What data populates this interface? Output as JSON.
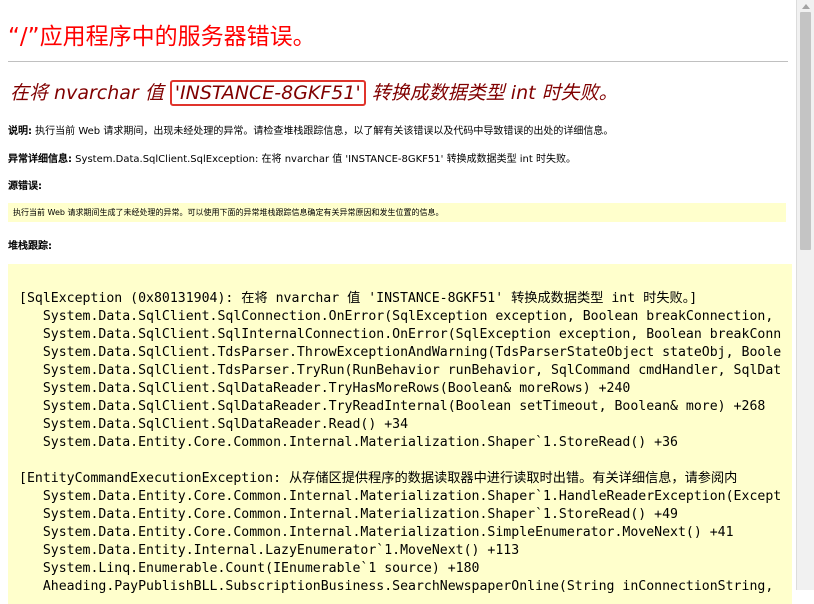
{
  "error": {
    "title": "“/”应用程序中的服务器错误。",
    "message_prefix": "在将 nvarchar 值 ",
    "message_value": "'INSTANCE-8GKF51'",
    "message_suffix": " 转换成数据类型 int 时失败。"
  },
  "description": {
    "label": "说明:",
    "text": " 执行当前 Web 请求期间，出现未经处理的异常。请检查堆栈跟踪信息，以了解有关该错误以及代码中导致错误的出处的详细信息。"
  },
  "exception_details": {
    "label": "异常详细信息:",
    "text": " System.Data.SqlClient.SqlException: 在将 nvarchar 值 'INSTANCE-8GKF51' 转换成数据类型 int 时失败。"
  },
  "source_error": {
    "label": "源错误:",
    "note": "执行当前 Web 请求期间生成了未经处理的异常。可以使用下面的异常堆栈跟踪信息确定有关异常原因和发生位置的信息。"
  },
  "stack_trace": {
    "label": "堆栈跟踪:",
    "text": "[SqlException (0x80131904): 在将 nvarchar 值 'INSTANCE-8GKF51' 转换成数据类型 int 时失败。]\n   System.Data.SqlClient.SqlConnection.OnError(SqlException exception, Boolean breakConnection,\n   System.Data.SqlClient.SqlInternalConnection.OnError(SqlException exception, Boolean breakConn\n   System.Data.SqlClient.TdsParser.ThrowExceptionAndWarning(TdsParserStateObject stateObj, Boole\n   System.Data.SqlClient.TdsParser.TryRun(RunBehavior runBehavior, SqlCommand cmdHandler, SqlDat\n   System.Data.SqlClient.SqlDataReader.TryHasMoreRows(Boolean& moreRows) +240\n   System.Data.SqlClient.SqlDataReader.TryReadInternal(Boolean setTimeout, Boolean& more) +268\n   System.Data.SqlClient.SqlDataReader.Read() +34\n   System.Data.Entity.Core.Common.Internal.Materialization.Shaper`1.StoreRead() +36\n\n[EntityCommandExecutionException: 从存储区提供程序的数据读取器中进行读取时出错。有关详细信息，请参阅内\n   System.Data.Entity.Core.Common.Internal.Materialization.Shaper`1.HandleReaderException(Except\n   System.Data.Entity.Core.Common.Internal.Materialization.Shaper`1.StoreRead() +49\n   System.Data.Entity.Core.Common.Internal.Materialization.SimpleEnumerator.MoveNext() +41\n   System.Data.Entity.Internal.LazyEnumerator`1.MoveNext() +113\n   System.Linq.Enumerable.Count(IEnumerable`1 source) +180\n   Aheading.PayPublishBLL.SubscriptionBusiness.SearchNewspaperOnline(String inConnectionString,"
  }
}
